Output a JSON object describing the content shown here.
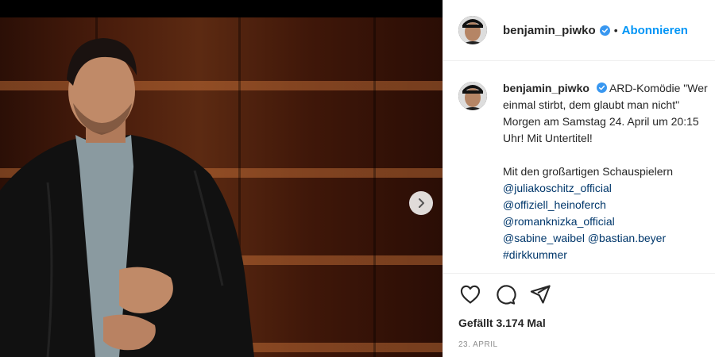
{
  "post": {
    "image_alt": "",
    "next_icon": "chevron-right-icon"
  },
  "header": {
    "username": "benjamin_piwko",
    "separator": "•",
    "follow_label": "Abonnieren"
  },
  "caption": {
    "username": "benjamin_piwko",
    "text_1": "ARD-Komödie \"Wer einmal stirbt, dem glaubt man nicht\" Morgen am Samstag 24. April um 20:15 Uhr! Mit Untertitel!",
    "text_2": "Mit den großartigen Schauspielern",
    "mentions": [
      "@juliakoschitz_official",
      "@offiziell_heinoferch",
      "@romanknizka_official"
    ],
    "mention_4": "@sabine_waibel",
    "mention_5": "@bastian.beyer",
    "hashtag": "#dirkkummer"
  },
  "actions": {
    "like_icon": "heart-icon",
    "comment_icon": "comment-icon",
    "share_icon": "share-icon"
  },
  "likes_text": "Gefällt 3.174 Mal",
  "date_text": "23. APRIL",
  "colors": {
    "link": "#00376b",
    "follow": "#0095f6",
    "verified": "#3897f0"
  }
}
